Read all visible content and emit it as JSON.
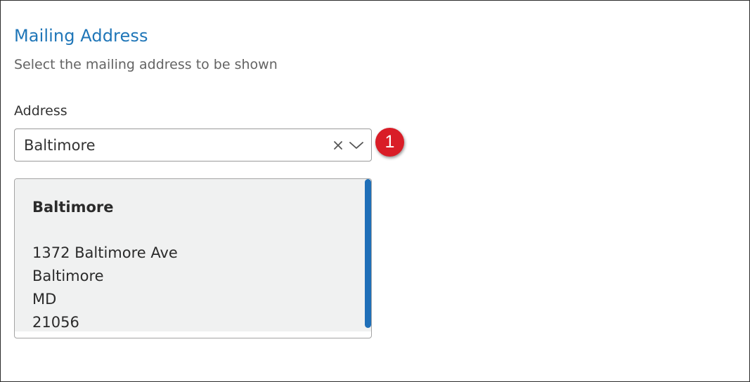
{
  "section": {
    "title": "Mailing Address",
    "description": "Select the mailing address to be shown"
  },
  "address_field": {
    "label": "Address",
    "selected_value": "Baltimore",
    "clear_icon": "close-icon",
    "dropdown_icon": "chevron-down-icon"
  },
  "step_badge": {
    "number": "1",
    "color": "#d91d27"
  },
  "address_card": {
    "name": "Baltimore",
    "street": "1372 Baltimore Ave",
    "city": "Baltimore",
    "state": "MD",
    "zip": "21056"
  },
  "colors": {
    "accent": "#1f76b8",
    "scrollbar": "#1f6fb8",
    "card_background": "#f0f1f1"
  }
}
